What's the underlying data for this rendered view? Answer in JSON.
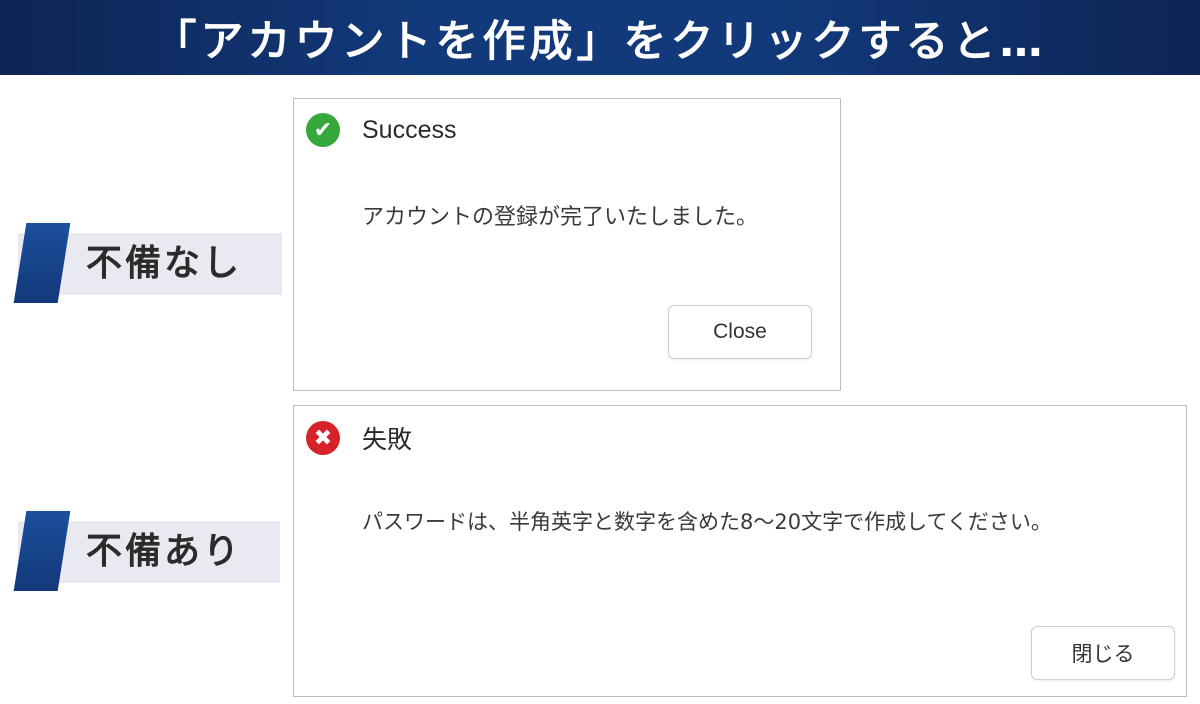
{
  "header": {
    "title": "「アカウントを作成」をクリックすると…"
  },
  "cases": [
    {
      "label": "不備なし",
      "dialog": {
        "status": "success",
        "icon": "check-circle-icon",
        "icon_glyph": "✔",
        "icon_color": "#36a83b",
        "title": "Success",
        "message": "アカウントの登録が完了いたしました。",
        "button_label": "Close"
      }
    },
    {
      "label": "不備あり",
      "dialog": {
        "status": "error",
        "icon": "x-circle-icon",
        "icon_glyph": "✖",
        "icon_color": "#d6232a",
        "title": "失敗",
        "message": "パスワードは、半角英字と数字を含めた8〜20文字で作成してください。",
        "button_label": "閉じる"
      }
    }
  ],
  "colors": {
    "banner": "#12397a",
    "tag_background": "#e9e9f1",
    "tag_stripe": "#1c4f9c"
  }
}
